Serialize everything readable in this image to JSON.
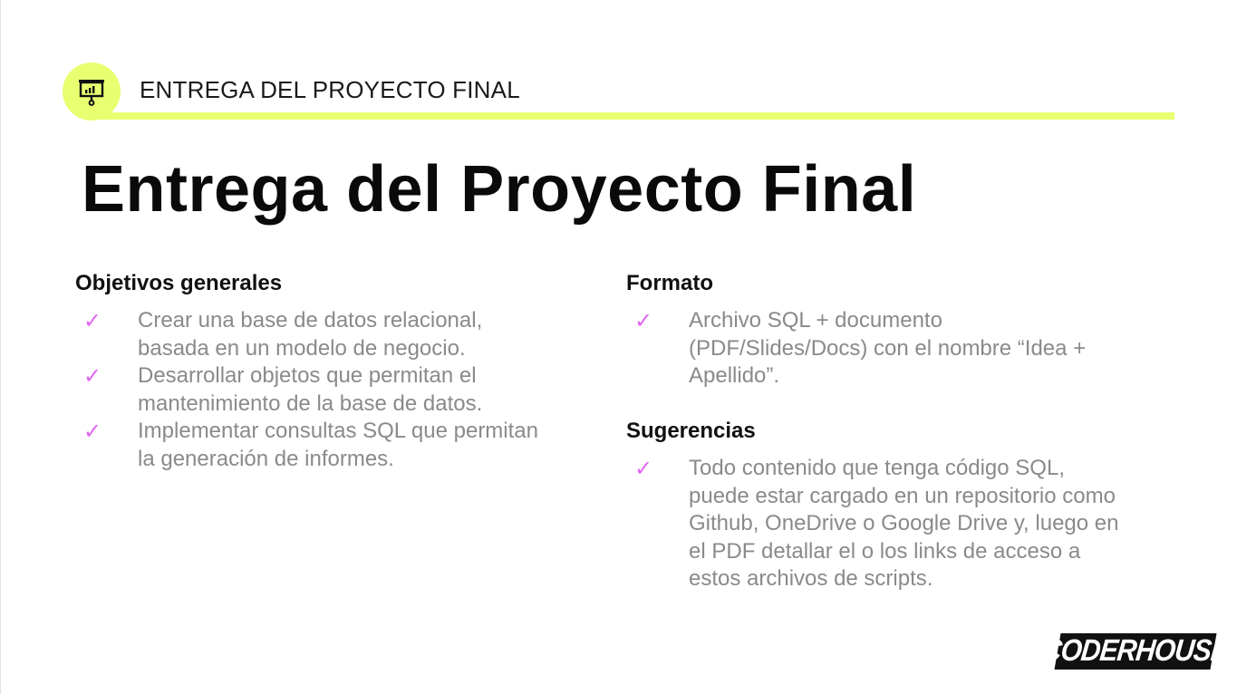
{
  "header": {
    "label": "ENTREGA DEL PROYECTO FINAL",
    "icon": "presentation-board-icon",
    "accent_color": "#e8ff70"
  },
  "title": "Entrega del Proyecto Final",
  "left_section": {
    "heading": "Objetivos generales",
    "items": [
      {
        "text": "Crear una base de datos relacional, basada en un modelo de negocio."
      },
      {
        "text": "Desarrollar objetos que permitan el mantenimiento de la base de datos."
      },
      {
        "text": "Implementar consultas SQL que permitan la generación de informes."
      }
    ]
  },
  "format_section": {
    "heading": "Formato",
    "items": [
      {
        "text": "Archivo SQL + documento (PDF/Slides/Docs) con el nombre “Idea + Apellido”."
      }
    ]
  },
  "suggestions_section": {
    "heading": "Sugerencias",
    "items": [
      {
        "text": "Todo contenido que tenga código SQL, puede estar cargado en un repositorio como Github, OneDrive o Google Drive y, luego en el PDF detallar el o los links de acceso a estos archivos de scripts."
      }
    ]
  },
  "check_glyph": "✓",
  "check_color": "#e066f0",
  "logo_text": "CODERHOUSE"
}
